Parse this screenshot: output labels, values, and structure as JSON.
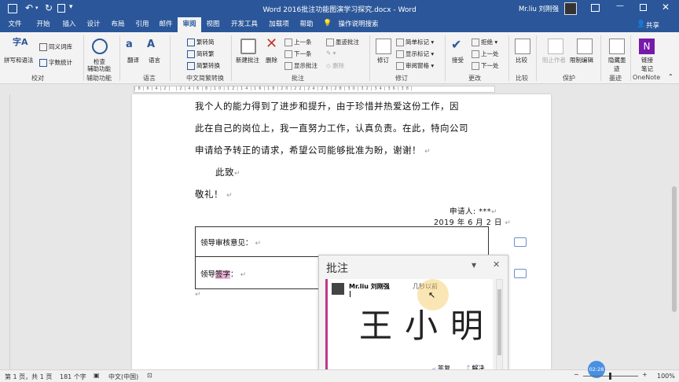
{
  "titlebar": {
    "doc_title": "Word 2016批注功能图演学习探究.docx - Word",
    "user": "Mr.liu 刘刚强",
    "share": "共享"
  },
  "tabs": [
    "文件",
    "开始",
    "插入",
    "设计",
    "布局",
    "引用",
    "邮件",
    "审阅",
    "视图",
    "开发工具",
    "加载项",
    "帮助",
    "操作说明搜索"
  ],
  "ribbon": {
    "proofing": {
      "spell": "拼写和语法",
      "thesaurus": "同义词库",
      "wordcount": "字数统计",
      "label": "校对"
    },
    "accessibility": {
      "check": "检查",
      "assist": "辅助功能",
      "label": "辅助功能"
    },
    "language": {
      "translate": "翻译",
      "language": "语言",
      "label": "语言"
    },
    "chinese": {
      "t2s": "繁转简",
      "s2t": "简转繁",
      "convert": "简繁转换",
      "label": "中文简繁转换"
    },
    "comments": {
      "new": "新建批注",
      "delete": "删除",
      "prev": "上一条",
      "next": "下一条",
      "show": "显示批注",
      "ink": "墨迹批注",
      "label": "批注"
    },
    "tracking": {
      "track": "修订",
      "simple": "简单标记",
      "show_markup": "显示标记",
      "pane": "审阅窗格",
      "label": "修订"
    },
    "changes": {
      "accept": "接受",
      "reject": "拒绝",
      "prev": "上一处",
      "next": "下一处",
      "label": "更改"
    },
    "compare": {
      "compare": "比较",
      "label": "比较"
    },
    "protect": {
      "block": "阻止作者",
      "restrict": "限制编辑",
      "label": "保护"
    },
    "ink": {
      "hide": "隐藏墨",
      "trace": "迹",
      "label": "墨迹"
    },
    "onenote": {
      "linked": "链接",
      "notes": "笔记",
      "label": "OneNote"
    }
  },
  "document": {
    "line1": "我个人的能力得到了进步和提升，由于珍惜并热爱这份工作，因",
    "line2": "此在自己的岗位上，我一直努力工作，认真负责。在此，特向公司",
    "line3": "申请给予转正的请求，希望公司能够批准为盼，谢谢！",
    "greet1": "此致",
    "greet2": "敬礼！",
    "applicant": "申请人: ***",
    "date": "2019 年 6 月 2 日",
    "table_row1": "领导审核意见：",
    "table_row2_prefix": "领导",
    "table_row2_highlight": "签字",
    "table_row2_suffix": "："
  },
  "comment_pane": {
    "title": "批注",
    "author": "Mr.liu 刘刚强",
    "time": "几秒以前",
    "ink_text": "王小明",
    "reply": "答复",
    "resolve": "解决"
  },
  "statusbar": {
    "page": "第 1 页，共 1 页",
    "words": "181 个字",
    "lang": "中文(中国)",
    "zoom": "100%",
    "video_time": "02:28"
  },
  "colors": {
    "accent": "#2b579a",
    "comment_highlight": "#e8b3d8",
    "comment_bar": "#c2378a"
  }
}
